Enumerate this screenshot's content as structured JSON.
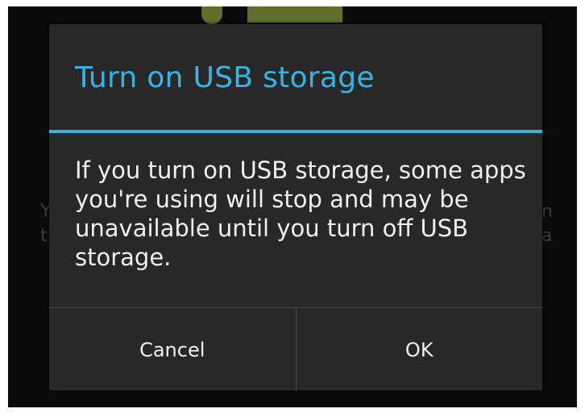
{
  "dialog": {
    "title": "Turn on USB storage",
    "message": "If you turn on USB storage, some apps you're using will stop and may be unavailable until you turn off USB storage.",
    "buttons": {
      "cancel_label": "Cancel",
      "ok_label": "OK"
    }
  },
  "colors": {
    "accent": "#33b5e5",
    "dialog_background": "#282828",
    "screen_background": "#0b0b0b",
    "robot": "#5f6e2a"
  }
}
